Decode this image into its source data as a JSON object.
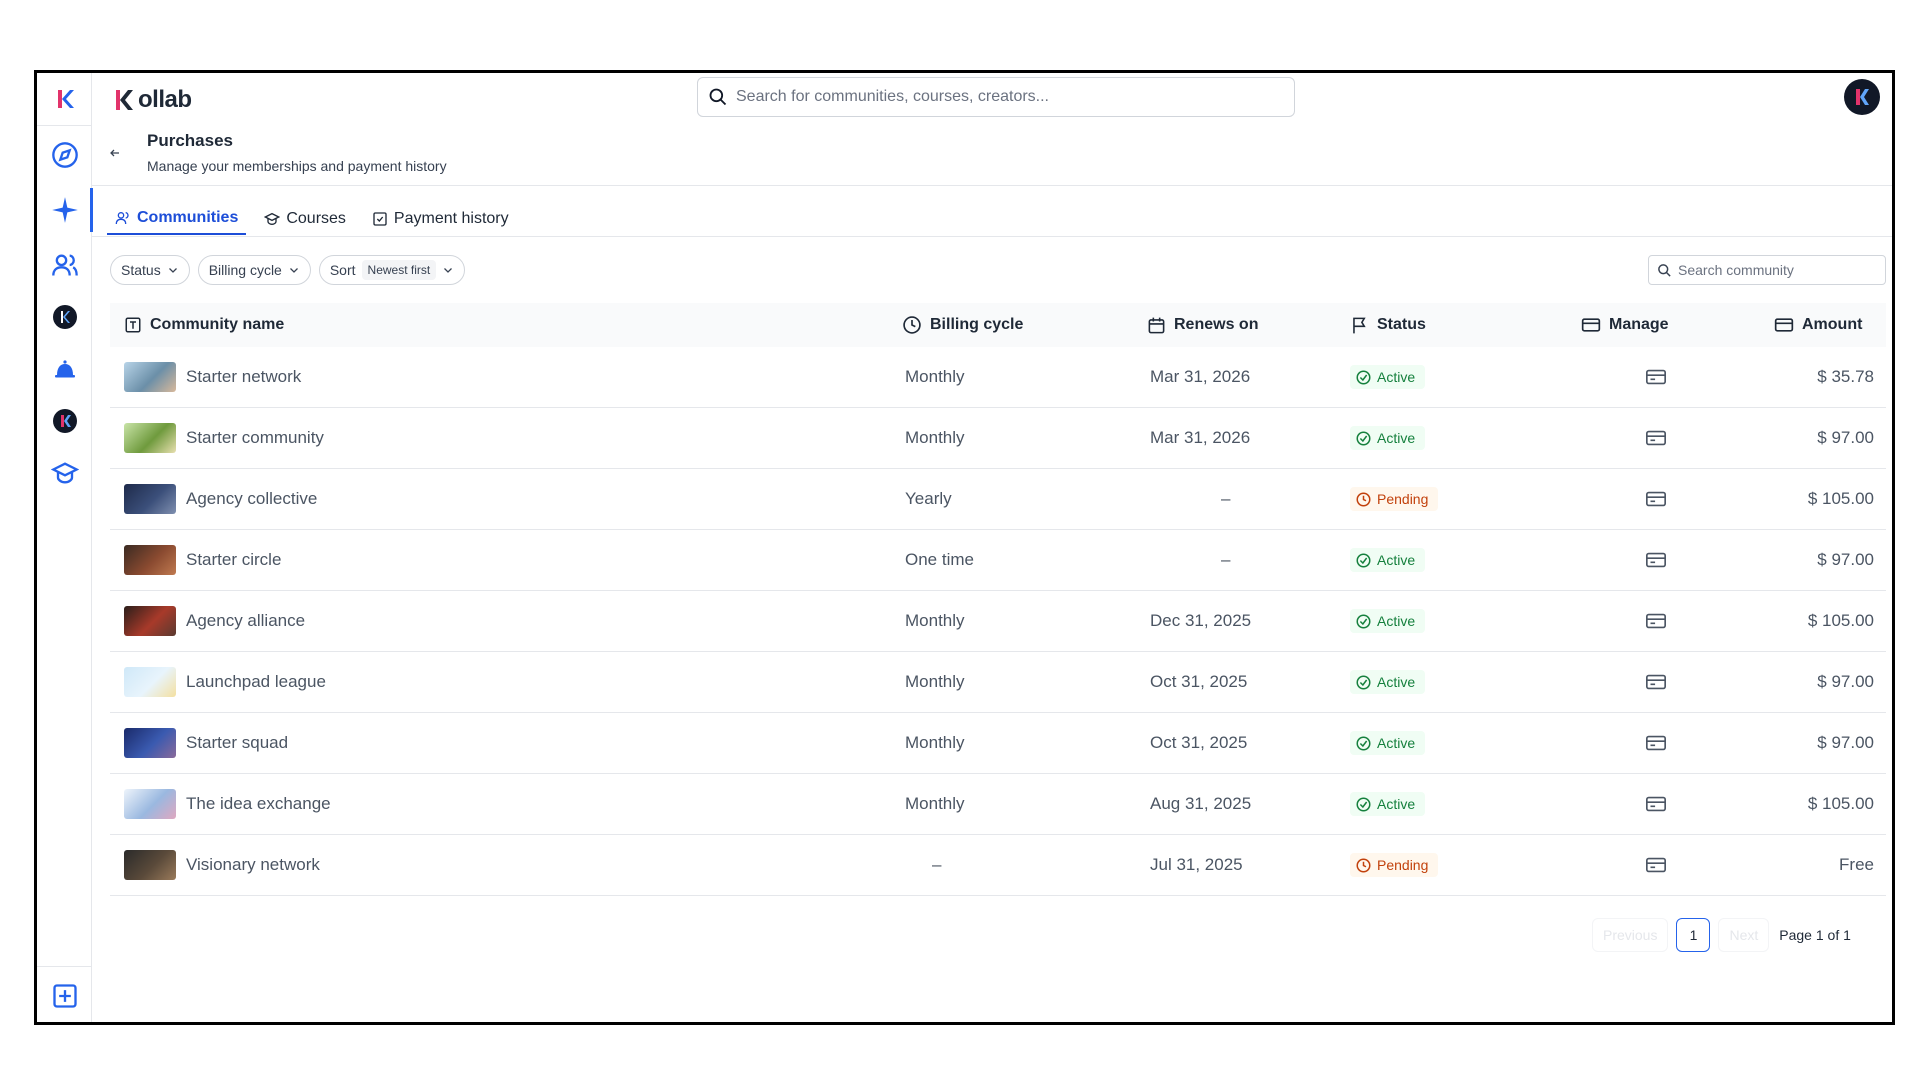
{
  "brand": {
    "logo_text": "ollab",
    "logo_k": "K"
  },
  "search": {
    "placeholder": "Search for communities, courses, creators..."
  },
  "page": {
    "title": "Purchases",
    "subtitle": "Manage your memberships and payment history"
  },
  "tabs": [
    {
      "label": "Communities",
      "icon": "users-icon",
      "active": true
    },
    {
      "label": "Courses",
      "icon": "graduation-cap-icon",
      "active": false
    },
    {
      "label": "Payment history",
      "icon": "check-square-icon",
      "active": false
    }
  ],
  "filters": {
    "status": "Status",
    "billing": "Billing cycle",
    "sort_label": "Sort",
    "sort_value": "Newest first"
  },
  "community_search": {
    "placeholder": "Search community"
  },
  "columns": {
    "name": "Community name",
    "billing": "Billing cycle",
    "renews": "Renews on",
    "status": "Status",
    "manage": "Manage",
    "amount": "Amount"
  },
  "rows": [
    {
      "name": "Starter network",
      "billing": "Monthly",
      "renews": "Mar 31, 2026",
      "status": "Active",
      "amount": "$ 35.78",
      "thumb": [
        "#b8d4e8",
        "#6b8fa8",
        "#d9b99b"
      ]
    },
    {
      "name": "Starter community",
      "billing": "Monthly",
      "renews": "Mar 31, 2026",
      "status": "Active",
      "amount": "$ 97.00",
      "thumb": [
        "#c9e4a8",
        "#6f9a3d",
        "#e8e0b0"
      ]
    },
    {
      "name": "Agency collective",
      "billing": "Yearly",
      "renews": "–",
      "status": "Pending",
      "amount": "$ 105.00",
      "thumb": [
        "#1e2a4a",
        "#3b4f7a",
        "#8090b0"
      ]
    },
    {
      "name": "Starter circle",
      "billing": "One time",
      "renews": "–",
      "status": "Active",
      "amount": "$ 97.00",
      "thumb": [
        "#3a2a22",
        "#8a4a30",
        "#c07a50"
      ]
    },
    {
      "name": "Agency alliance",
      "billing": "Monthly",
      "renews": "Dec 31, 2025",
      "status": "Active",
      "amount": "$ 105.00",
      "thumb": [
        "#2a1e1a",
        "#a83a2a",
        "#5a3a30"
      ]
    },
    {
      "name": "Launchpad league",
      "billing": "Monthly",
      "renews": "Oct 31, 2025",
      "status": "Active",
      "amount": "$ 97.00",
      "thumb": [
        "#cfe8f8",
        "#e8f4fc",
        "#f4e0a0"
      ]
    },
    {
      "name": "Starter squad",
      "billing": "Monthly",
      "renews": "Oct 31, 2025",
      "status": "Active",
      "amount": "$ 97.00",
      "thumb": [
        "#1a2a6a",
        "#3a5ab0",
        "#8a6a9a"
      ]
    },
    {
      "name": "The idea exchange",
      "billing": "Monthly",
      "renews": "Aug 31, 2025",
      "status": "Active",
      "amount": "$ 105.00",
      "thumb": [
        "#eef4fb",
        "#9ab8e0",
        "#e0a8c0"
      ]
    },
    {
      "name": "Visionary network",
      "billing": "–",
      "renews": "Jul 31, 2025",
      "status": "Pending",
      "amount": "Free",
      "thumb": [
        "#2a2a2a",
        "#5a4a3a",
        "#9a7a5a"
      ]
    }
  ],
  "pagination": {
    "previous": "Previous",
    "current": "1",
    "next": "Next",
    "info": "Page 1 of 1"
  },
  "rail_icons": [
    "kollab-k-icon",
    "compass-icon",
    "sparkle-icon",
    "users-icon",
    "community-k-icon",
    "bell-icon",
    "community-k-icon",
    "graduation-cap-icon",
    "add-square-icon"
  ],
  "colors": {
    "accent": "#2563eb",
    "active_text": "#15803d",
    "pending_text": "#c2410c",
    "brand_pink": "#e2336b"
  }
}
